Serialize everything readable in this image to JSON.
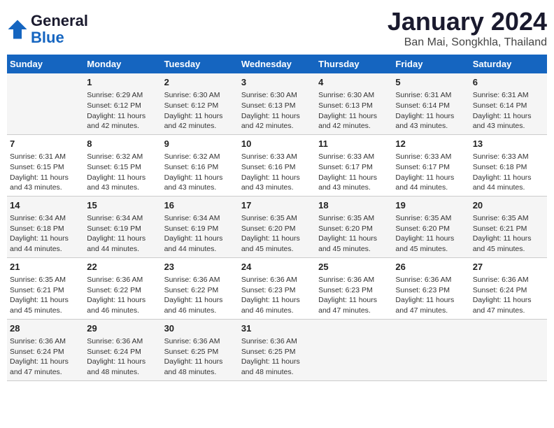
{
  "header": {
    "logo_line1": "General",
    "logo_line2": "Blue",
    "title": "January 2024",
    "subtitle": "Ban Mai, Songkhla, Thailand"
  },
  "columns": [
    "Sunday",
    "Monday",
    "Tuesday",
    "Wednesday",
    "Thursday",
    "Friday",
    "Saturday"
  ],
  "weeks": [
    [
      {
        "day": "",
        "text": ""
      },
      {
        "day": "1",
        "text": "Sunrise: 6:29 AM\nSunset: 6:12 PM\nDaylight: 11 hours\nand 42 minutes."
      },
      {
        "day": "2",
        "text": "Sunrise: 6:30 AM\nSunset: 6:12 PM\nDaylight: 11 hours\nand 42 minutes."
      },
      {
        "day": "3",
        "text": "Sunrise: 6:30 AM\nSunset: 6:13 PM\nDaylight: 11 hours\nand 42 minutes."
      },
      {
        "day": "4",
        "text": "Sunrise: 6:30 AM\nSunset: 6:13 PM\nDaylight: 11 hours\nand 42 minutes."
      },
      {
        "day": "5",
        "text": "Sunrise: 6:31 AM\nSunset: 6:14 PM\nDaylight: 11 hours\nand 43 minutes."
      },
      {
        "day": "6",
        "text": "Sunrise: 6:31 AM\nSunset: 6:14 PM\nDaylight: 11 hours\nand 43 minutes."
      }
    ],
    [
      {
        "day": "7",
        "text": "Sunrise: 6:31 AM\nSunset: 6:15 PM\nDaylight: 11 hours\nand 43 minutes."
      },
      {
        "day": "8",
        "text": "Sunrise: 6:32 AM\nSunset: 6:15 PM\nDaylight: 11 hours\nand 43 minutes."
      },
      {
        "day": "9",
        "text": "Sunrise: 6:32 AM\nSunset: 6:16 PM\nDaylight: 11 hours\nand 43 minutes."
      },
      {
        "day": "10",
        "text": "Sunrise: 6:33 AM\nSunset: 6:16 PM\nDaylight: 11 hours\nand 43 minutes."
      },
      {
        "day": "11",
        "text": "Sunrise: 6:33 AM\nSunset: 6:17 PM\nDaylight: 11 hours\nand 43 minutes."
      },
      {
        "day": "12",
        "text": "Sunrise: 6:33 AM\nSunset: 6:17 PM\nDaylight: 11 hours\nand 44 minutes."
      },
      {
        "day": "13",
        "text": "Sunrise: 6:33 AM\nSunset: 6:18 PM\nDaylight: 11 hours\nand 44 minutes."
      }
    ],
    [
      {
        "day": "14",
        "text": "Sunrise: 6:34 AM\nSunset: 6:18 PM\nDaylight: 11 hours\nand 44 minutes."
      },
      {
        "day": "15",
        "text": "Sunrise: 6:34 AM\nSunset: 6:19 PM\nDaylight: 11 hours\nand 44 minutes."
      },
      {
        "day": "16",
        "text": "Sunrise: 6:34 AM\nSunset: 6:19 PM\nDaylight: 11 hours\nand 44 minutes."
      },
      {
        "day": "17",
        "text": "Sunrise: 6:35 AM\nSunset: 6:20 PM\nDaylight: 11 hours\nand 45 minutes."
      },
      {
        "day": "18",
        "text": "Sunrise: 6:35 AM\nSunset: 6:20 PM\nDaylight: 11 hours\nand 45 minutes."
      },
      {
        "day": "19",
        "text": "Sunrise: 6:35 AM\nSunset: 6:20 PM\nDaylight: 11 hours\nand 45 minutes."
      },
      {
        "day": "20",
        "text": "Sunrise: 6:35 AM\nSunset: 6:21 PM\nDaylight: 11 hours\nand 45 minutes."
      }
    ],
    [
      {
        "day": "21",
        "text": "Sunrise: 6:35 AM\nSunset: 6:21 PM\nDaylight: 11 hours\nand 45 minutes."
      },
      {
        "day": "22",
        "text": "Sunrise: 6:36 AM\nSunset: 6:22 PM\nDaylight: 11 hours\nand 46 minutes."
      },
      {
        "day": "23",
        "text": "Sunrise: 6:36 AM\nSunset: 6:22 PM\nDaylight: 11 hours\nand 46 minutes."
      },
      {
        "day": "24",
        "text": "Sunrise: 6:36 AM\nSunset: 6:23 PM\nDaylight: 11 hours\nand 46 minutes."
      },
      {
        "day": "25",
        "text": "Sunrise: 6:36 AM\nSunset: 6:23 PM\nDaylight: 11 hours\nand 47 minutes."
      },
      {
        "day": "26",
        "text": "Sunrise: 6:36 AM\nSunset: 6:23 PM\nDaylight: 11 hours\nand 47 minutes."
      },
      {
        "day": "27",
        "text": "Sunrise: 6:36 AM\nSunset: 6:24 PM\nDaylight: 11 hours\nand 47 minutes."
      }
    ],
    [
      {
        "day": "28",
        "text": "Sunrise: 6:36 AM\nSunset: 6:24 PM\nDaylight: 11 hours\nand 47 minutes."
      },
      {
        "day": "29",
        "text": "Sunrise: 6:36 AM\nSunset: 6:24 PM\nDaylight: 11 hours\nand 48 minutes."
      },
      {
        "day": "30",
        "text": "Sunrise: 6:36 AM\nSunset: 6:25 PM\nDaylight: 11 hours\nand 48 minutes."
      },
      {
        "day": "31",
        "text": "Sunrise: 6:36 AM\nSunset: 6:25 PM\nDaylight: 11 hours\nand 48 minutes."
      },
      {
        "day": "",
        "text": ""
      },
      {
        "day": "",
        "text": ""
      },
      {
        "day": "",
        "text": ""
      }
    ]
  ]
}
